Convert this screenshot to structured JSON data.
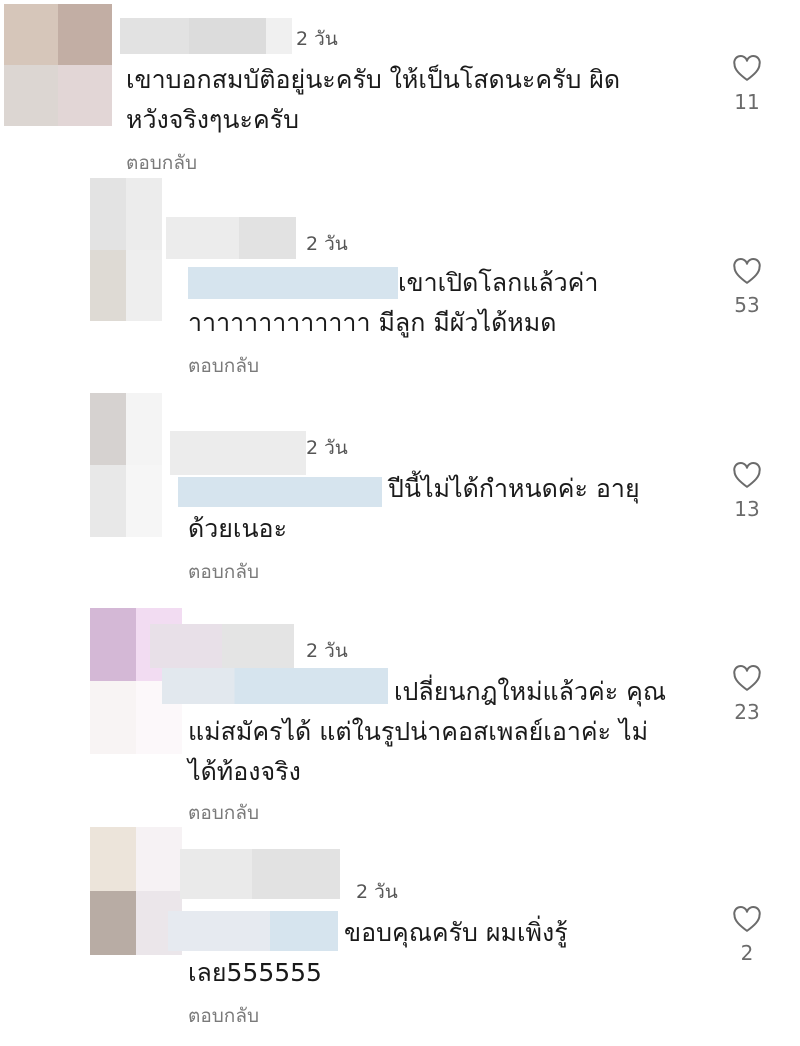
{
  "comments": [
    {
      "time": "2 วัน",
      "text_line1": "เขาบอกสมบัติอยู่นะครับ ให้เป็นโสดนะครับ ผิด",
      "text_line2": "หวังจริงๆนะครับ",
      "reply_label": "ตอบกลับ",
      "likes": "11",
      "avatar_colors": [
        "#d6c6ba",
        "#c2aea4",
        "#dcd6d2",
        "#e2d6d6"
      ]
    },
    {
      "time": "2 วัน",
      "text_line1": "เขาเปิดโลกแล้วค่า",
      "text_line2": "าาาาาาาาาาาาา มีลูก มีผัวได้หมด",
      "reply_label": "ตอบกลับ",
      "likes": "53",
      "avatar_colors": [
        "#e3e3e3",
        "#ececec",
        "#dedad4",
        "#eeeeee"
      ]
    },
    {
      "time": "2 วัน",
      "text_line1": "ปีนี้ไม่ได้กำหนดค่ะ อายุ",
      "text_line2": "ด้วยเนอะ",
      "reply_label": "ตอบกลับ",
      "likes": "13",
      "avatar_colors": [
        "#d6d2d0",
        "#f4f4f4",
        "#e8e8e8",
        "#f6f6f6"
      ]
    },
    {
      "time": "2 วัน",
      "text_line1": "เปลี่ยนกฎใหม่แล้วค่ะ คุณ",
      "text_line2": "แม่สมัครได้ แต่ในรูปน่าคอสเพลย์เอาค่ะ ไม่",
      "text_line3": "ได้ท้องจริง",
      "reply_label": "ตอบกลับ",
      "likes": "23",
      "avatar_colors": [
        "#d4b8d6",
        "#f2dcf2",
        "#f8f4f4",
        "#fcf8fa"
      ]
    },
    {
      "time": "2 วัน",
      "text_line1": "ขอบคุณครับ ผมเพิ่งรู้",
      "text_line2": "เลย555555",
      "reply_label": "ตอบกลับ",
      "likes": "2",
      "avatar_colors": [
        "#ece4da",
        "#f6f2f4",
        "#b8aca4",
        "#ebe6ea"
      ]
    }
  ],
  "colors": {
    "text": "#1a1a1a",
    "meta": "#555555",
    "reply": "#7a7a7a",
    "like_icon": "#6b6b6b",
    "redact_gray": "#e4e4e4",
    "redact_blue": "#d6e4ee"
  }
}
